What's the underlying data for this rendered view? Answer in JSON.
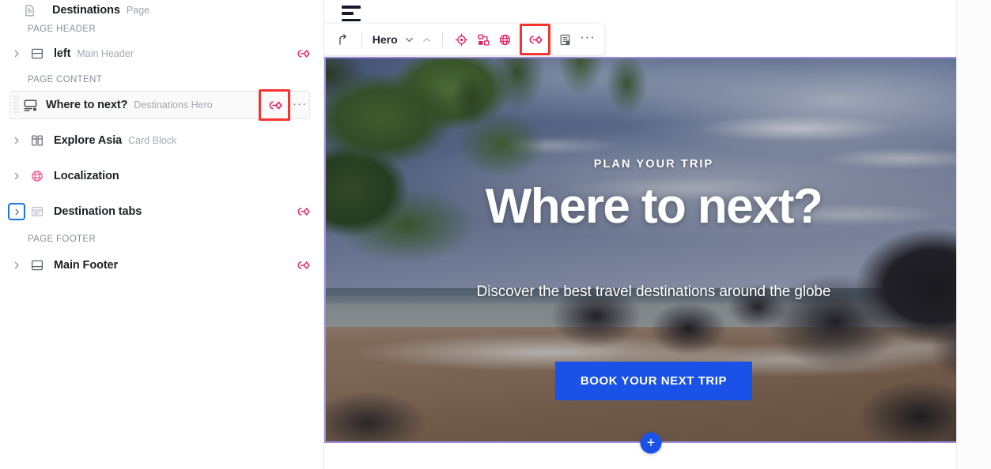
{
  "sidebar": {
    "page": {
      "title": "Destinations",
      "type_label": "Page",
      "icon": "document-icon"
    },
    "sections": [
      {
        "label": "PAGE HEADER",
        "items": [
          {
            "title": "left",
            "subtitle": "Main Header",
            "icon": "layout-header-icon",
            "expandable": true,
            "has_link_icon": true,
            "selected": false,
            "highlighted": false
          }
        ]
      },
      {
        "label": "PAGE CONTENT",
        "items": [
          {
            "title": "Where to next?",
            "subtitle": "Destinations Hero",
            "icon": "hero-block-icon",
            "expandable": false,
            "has_link_icon": true,
            "selected": true,
            "highlighted": true,
            "has_kebab": true
          },
          {
            "title": "Explore Asia",
            "subtitle": "Card Block",
            "icon": "card-block-icon",
            "expandable": true,
            "has_link_icon": false,
            "selected": false,
            "highlighted": false
          },
          {
            "title": "Localization",
            "subtitle": "",
            "icon": "globe-icon",
            "expandable": true,
            "has_link_icon": false,
            "selected": false,
            "highlighted": false
          },
          {
            "title": "Destination tabs",
            "subtitle": "",
            "icon": "tabs-icon",
            "expandable": true,
            "chevron_focused": true,
            "has_link_icon": true,
            "selected": false,
            "highlighted": false
          }
        ]
      },
      {
        "label": "PAGE FOOTER",
        "items": [
          {
            "title": "Main Footer",
            "subtitle": "",
            "icon": "layout-footer-icon",
            "expandable": true,
            "has_link_icon": true,
            "selected": false,
            "highlighted": false
          }
        ]
      }
    ]
  },
  "toolbar": {
    "menu_icon": "hamburger-menu-icon",
    "move_up_label": "move-up-arrow-icon",
    "block_name": "Hero",
    "caret_down": "chevron-down-icon",
    "caret_up": "chevron-up-icon",
    "actions": [
      {
        "name": "target-settings-icon",
        "highlighted": false
      },
      {
        "name": "duplicate-blocks-icon",
        "highlighted": false
      },
      {
        "name": "globe-icon",
        "highlighted": false
      },
      {
        "name": "personalization-link-icon",
        "highlighted": true
      },
      {
        "name": "clipboard-form-icon",
        "highlighted": false
      }
    ],
    "more_label": "···"
  },
  "hero": {
    "eyebrow": "PLAN YOUR TRIP",
    "title": "Where to next?",
    "subtitle": "Discover the best travel destinations around the globe",
    "cta_label": "BOOK YOUR NEXT TRIP",
    "cta_color": "#1a52e8",
    "selection_border_color": "#9c8ce0"
  },
  "canvas": {
    "add_block_label": "+",
    "add_block_color": "#1a52e8"
  },
  "colors": {
    "accent_pink": "#e61e64",
    "highlight_red": "#f5332f",
    "focus_blue": "#1a73e8",
    "brand_blue": "#1a52e8",
    "selection_purple": "#9c8ce0"
  }
}
